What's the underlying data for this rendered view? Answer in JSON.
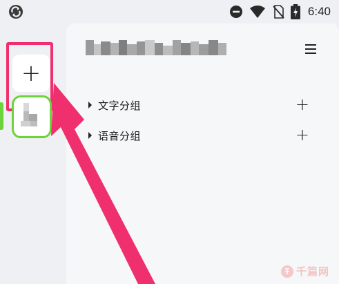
{
  "status_bar": {
    "time": "6:40",
    "icons": [
      "app-sync-icon",
      "do-not-disturb-icon",
      "wifi-icon",
      "no-sim-icon",
      "battery-charging-icon"
    ]
  },
  "rail": {
    "new_group_label": "+",
    "highlight_color": "#ef2f6e",
    "active_color": "#6cd43a"
  },
  "panel": {
    "menu_icon": "hamburger-menu-icon",
    "groups": [
      {
        "label": "文字分组",
        "add_label": "+"
      },
      {
        "label": "语音分组",
        "add_label": "+"
      }
    ]
  },
  "watermark": {
    "text": "千篇网"
  }
}
